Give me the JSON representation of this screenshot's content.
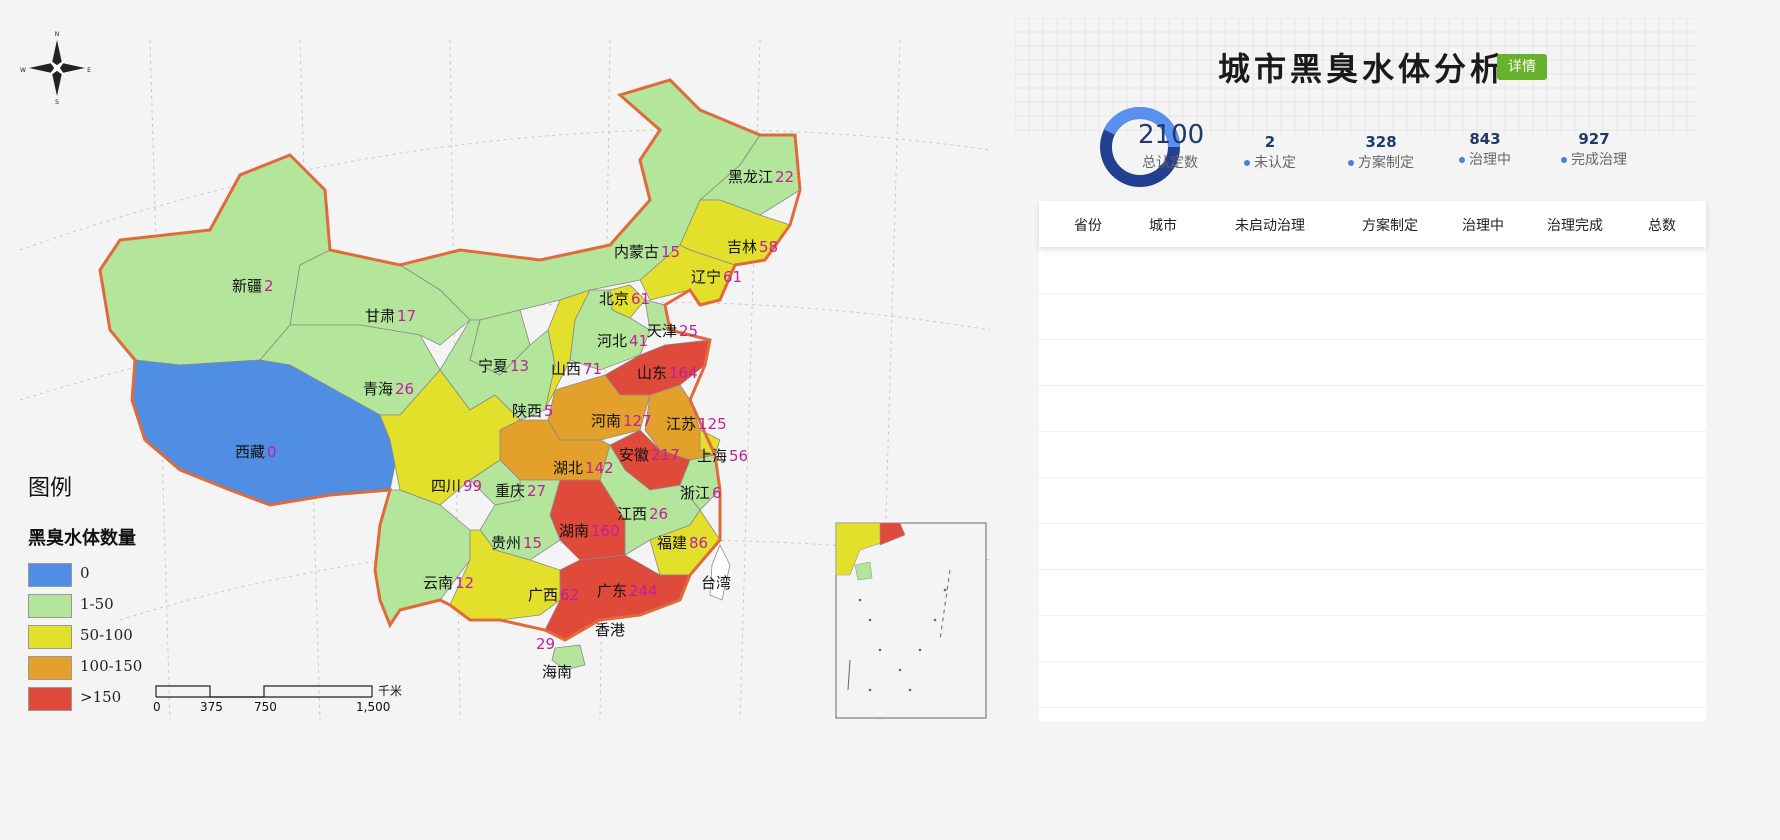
{
  "map": {
    "provinces": [
      {
        "name": "黑龙江",
        "count": "22",
        "color": "#b3e59a"
      },
      {
        "name": "吉林",
        "count": "58",
        "color": "#e2e02a"
      },
      {
        "name": "辽宁",
        "count": "61",
        "color": "#e2e02a"
      },
      {
        "name": "内蒙古",
        "count": "15",
        "color": "#b3e59a"
      },
      {
        "name": "北京",
        "count": "61",
        "color": "#e2e02a"
      },
      {
        "name": "天津",
        "count": "25",
        "color": "#b3e59a"
      },
      {
        "name": "河北",
        "count": "41",
        "color": "#b3e59a"
      },
      {
        "name": "新疆",
        "count": "2",
        "color": "#b3e59a"
      },
      {
        "name": "甘肃",
        "count": "17",
        "color": "#b3e59a"
      },
      {
        "name": "宁夏",
        "count": "13",
        "color": "#b3e59a"
      },
      {
        "name": "山西",
        "count": "71",
        "color": "#e2e02a"
      },
      {
        "name": "山东",
        "count": "164",
        "color": "#e04a3a"
      },
      {
        "name": "青海",
        "count": "26",
        "color": "#b3e59a"
      },
      {
        "name": "陕西",
        "count": "5",
        "color": "#b3e59a"
      },
      {
        "name": "河南",
        "count": "127",
        "color": "#e3a12b"
      },
      {
        "name": "江苏",
        "count": "125",
        "color": "#e3a12b"
      },
      {
        "name": "上海",
        "count": "56",
        "color": "#e2e02a"
      },
      {
        "name": "西藏",
        "count": "0",
        "color": "#4f8ee2"
      },
      {
        "name": "湖北",
        "count": "142",
        "color": "#e3a12b"
      },
      {
        "name": "安徽",
        "count": "217",
        "color": "#e04a3a"
      },
      {
        "name": "四川",
        "count": "99",
        "color": "#e2e02a"
      },
      {
        "name": "重庆",
        "count": "27",
        "color": "#b3e59a"
      },
      {
        "name": "浙江",
        "count": "6",
        "color": "#b3e59a"
      },
      {
        "name": "江西",
        "count": "26",
        "color": "#b3e59a"
      },
      {
        "name": "湖南",
        "count": "160",
        "color": "#e04a3a"
      },
      {
        "name": "贵州",
        "count": "15",
        "color": "#b3e59a"
      },
      {
        "name": "福建",
        "count": "86",
        "color": "#e2e02a"
      },
      {
        "name": "云南",
        "count": "12",
        "color": "#b3e59a"
      },
      {
        "name": "广西",
        "count": "62",
        "color": "#e2e02a"
      },
      {
        "name": "广东",
        "count": "244",
        "color": "#e04a3a"
      },
      {
        "name": "台湾",
        "count": "",
        "color": "#ffffff"
      },
      {
        "name": "香港",
        "count": "",
        "color": "#ffffff"
      },
      {
        "name": "海南",
        "count": "29",
        "color": "#b3e59a"
      }
    ],
    "legend": {
      "title": "图例",
      "subtitle": "黑臭水体数量",
      "items": [
        {
          "label": "0",
          "color": "#4f8ee2"
        },
        {
          "label": "1-50",
          "color": "#b3e59a"
        },
        {
          "label": "50-100",
          "color": "#e2e02a"
        },
        {
          "label": "100-150",
          "color": "#e3a12b"
        },
        {
          "label": ">150",
          "color": "#e04a3a"
        }
      ]
    },
    "scale": {
      "ticks": [
        "0",
        "375",
        "750",
        "1,500"
      ],
      "unit": "千米"
    },
    "compass": {
      "labels": [
        "N",
        "E",
        "S",
        "W"
      ]
    }
  },
  "dashboard": {
    "title": "城市黑臭水体分析",
    "detail_button": "详情",
    "total": {
      "value": "2100",
      "label": "总认定数"
    },
    "stats": [
      {
        "value": "2",
        "label": "未认定"
      },
      {
        "value": "328",
        "label": "方案制定"
      },
      {
        "value": "843",
        "label": "治理中"
      },
      {
        "value": "927",
        "label": "完成治理"
      }
    ]
  },
  "table": {
    "headers": [
      "省份",
      "城市",
      "未启动治理",
      "方案制定",
      "治理中",
      "治理完成",
      "总数"
    ],
    "row_count": 10
  },
  "colors": {
    "boundary": "#e06a3a",
    "accent": "#4a7fe0",
    "donut_dark": "#23408e",
    "donut_light": "#5b8ff0",
    "button": "#67b22c"
  }
}
